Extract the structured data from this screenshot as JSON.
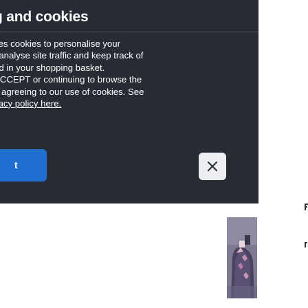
{
  "cookie_banner": {
    "title": "g and cookies",
    "body_lines": [
      "ses cookies to personalise your",
      ", analyse site traffic and keep track of",
      "ed in your shopping basket.",
      "ACCEPT or continuing to browse the",
      "e agreeing to our use of cookies. See"
    ],
    "policy_link": "vacy policy here.",
    "accept_label": "t",
    "close_icon": "close-icon",
    "colors": {
      "background": "#272b33",
      "accept": "#1f6fd1",
      "close_bg": "#eceef1"
    }
  },
  "thumbnail": {
    "icon": "product-image-thumbnail"
  },
  "edge": {
    "icon": "partially-visible-text"
  }
}
